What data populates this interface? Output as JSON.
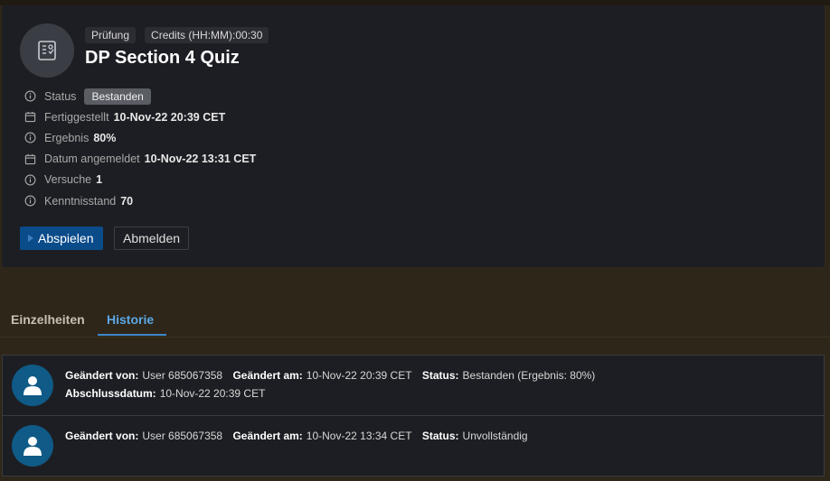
{
  "header": {
    "badges": [
      "Prüfung",
      "Credits (HH:MM):00:30"
    ],
    "title": "DP Section 4 Quiz",
    "course_icon": "quiz-icon"
  },
  "meta": {
    "status": {
      "label": "Status",
      "value": "Bestanden",
      "icon": "info-icon"
    },
    "completed": {
      "label": "Fertiggestellt",
      "value": "10-Nov-22 20:39 CET",
      "icon": "calendar-icon"
    },
    "result": {
      "label": "Ergebnis",
      "value": "80%",
      "icon": "info-icon"
    },
    "registered": {
      "label": "Datum angemeldet",
      "value": "10-Nov-22 13:31 CET",
      "icon": "calendar-icon"
    },
    "attempts": {
      "label": "Versuche",
      "value": "1",
      "icon": "info-icon"
    },
    "knowledge": {
      "label": "Kenntnisstand",
      "value": "70",
      "icon": "info-icon"
    }
  },
  "actions": {
    "play": "Abspielen",
    "unregister": "Abmelden"
  },
  "tabs": {
    "details": "Einzelheiten",
    "history": "Historie",
    "active": "Historie"
  },
  "history": [
    {
      "changed_by_label": "Geändert von:",
      "changed_by": "User 685067358",
      "changed_at_label": "Geändert am:",
      "changed_at": "10-Nov-22 20:39 CET",
      "status_label": "Status:",
      "status": "Bestanden (Ergebnis: 80%)",
      "completion_label": "Abschlussdatum:",
      "completion": "10-Nov-22 20:39 CET"
    },
    {
      "changed_by_label": "Geändert von:",
      "changed_by": "User 685067358",
      "changed_at_label": "Geändert am:",
      "changed_at": "10-Nov-22 13:34 CET",
      "status_label": "Status:",
      "status": "Unvollständig"
    }
  ],
  "colors": {
    "accent": "#5aa8e6",
    "primary_button": "#0a4b8a",
    "avatar": "#0f5a86"
  }
}
